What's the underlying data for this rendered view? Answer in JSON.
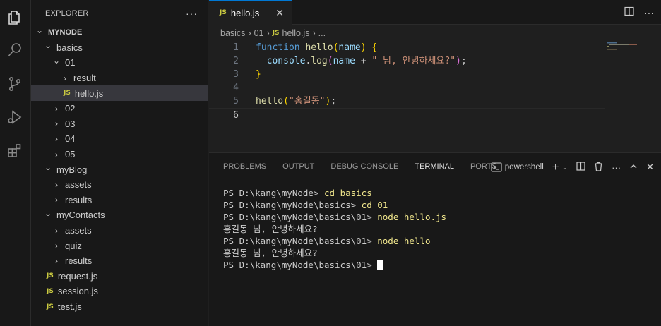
{
  "activity_bar": {
    "icons": [
      "files-icon",
      "search-icon",
      "source-control-icon",
      "run-debug-icon",
      "extensions-icon"
    ]
  },
  "sidebar": {
    "title": "EXPLORER",
    "more": "···",
    "tree": [
      {
        "label": "MYNODE",
        "chevron": "⌄",
        "depth": 0,
        "type": "root"
      },
      {
        "label": "basics",
        "chevron": "⌄",
        "depth": 1,
        "type": "folder"
      },
      {
        "label": "01",
        "chevron": "⌄",
        "depth": 2,
        "type": "folder"
      },
      {
        "label": "result",
        "chevron": "›",
        "depth": 3,
        "type": "folder"
      },
      {
        "label": "hello.js",
        "chevron": "",
        "depth": 3,
        "type": "js",
        "selected": true
      },
      {
        "label": "02",
        "chevron": "›",
        "depth": 2,
        "type": "folder"
      },
      {
        "label": "03",
        "chevron": "›",
        "depth": 2,
        "type": "folder"
      },
      {
        "label": "04",
        "chevron": "›",
        "depth": 2,
        "type": "folder"
      },
      {
        "label": "05",
        "chevron": "›",
        "depth": 2,
        "type": "folder"
      },
      {
        "label": "myBlog",
        "chevron": "⌄",
        "depth": 1,
        "type": "folder"
      },
      {
        "label": "assets",
        "chevron": "›",
        "depth": 2,
        "type": "folder"
      },
      {
        "label": "results",
        "chevron": "›",
        "depth": 2,
        "type": "folder"
      },
      {
        "label": "myContacts",
        "chevron": "⌄",
        "depth": 1,
        "type": "folder"
      },
      {
        "label": "assets",
        "chevron": "›",
        "depth": 2,
        "type": "folder"
      },
      {
        "label": "quiz",
        "chevron": "›",
        "depth": 2,
        "type": "folder"
      },
      {
        "label": "results",
        "chevron": "›",
        "depth": 2,
        "type": "folder"
      },
      {
        "label": "request.js",
        "chevron": "",
        "depth": 1,
        "type": "js"
      },
      {
        "label": "session.js",
        "chevron": "",
        "depth": 1,
        "type": "js"
      },
      {
        "label": "test.js",
        "chevron": "",
        "depth": 1,
        "type": "js"
      }
    ]
  },
  "editor": {
    "tab": {
      "badge": "JS",
      "label": "hello.js",
      "close": "✕"
    },
    "breadcrumb": [
      "basics",
      "01",
      "hello.js",
      "..."
    ],
    "breadcrumb_badge": "JS",
    "line_numbers": [
      "1",
      "2",
      "3",
      "4",
      "5",
      "6"
    ],
    "active_line": "6"
  },
  "panel": {
    "tabs": [
      "PROBLEMS",
      "OUTPUT",
      "DEBUG CONSOLE",
      "TERMINAL",
      "PORTS"
    ],
    "active_tab": "TERMINAL",
    "shell_label": "powershell",
    "terminal_lines": [
      {
        "prompt": "PS D:\\kang\\myNode> ",
        "cmd": "cd basics"
      },
      {
        "prompt": "PS D:\\kang\\myNode\\basics> ",
        "cmd": "cd 01"
      },
      {
        "prompt": "PS D:\\kang\\myNode\\basics\\01> ",
        "cmd": "node hello.js"
      },
      {
        "prompt": "홍길동 님, 안녕하세요?",
        "cmd": ""
      },
      {
        "prompt": "PS D:\\kang\\myNode\\basics\\01> ",
        "cmd": "node hello"
      },
      {
        "prompt": "홍길동 님, 안녕하세요?",
        "cmd": ""
      },
      {
        "prompt": "PS D:\\kang\\myNode\\basics\\01> ",
        "cmd": "",
        "cursor": true
      }
    ]
  },
  "colors": {
    "accent": "#0078d4",
    "js_badge": "#cbcb41",
    "selection": "#37373d"
  }
}
